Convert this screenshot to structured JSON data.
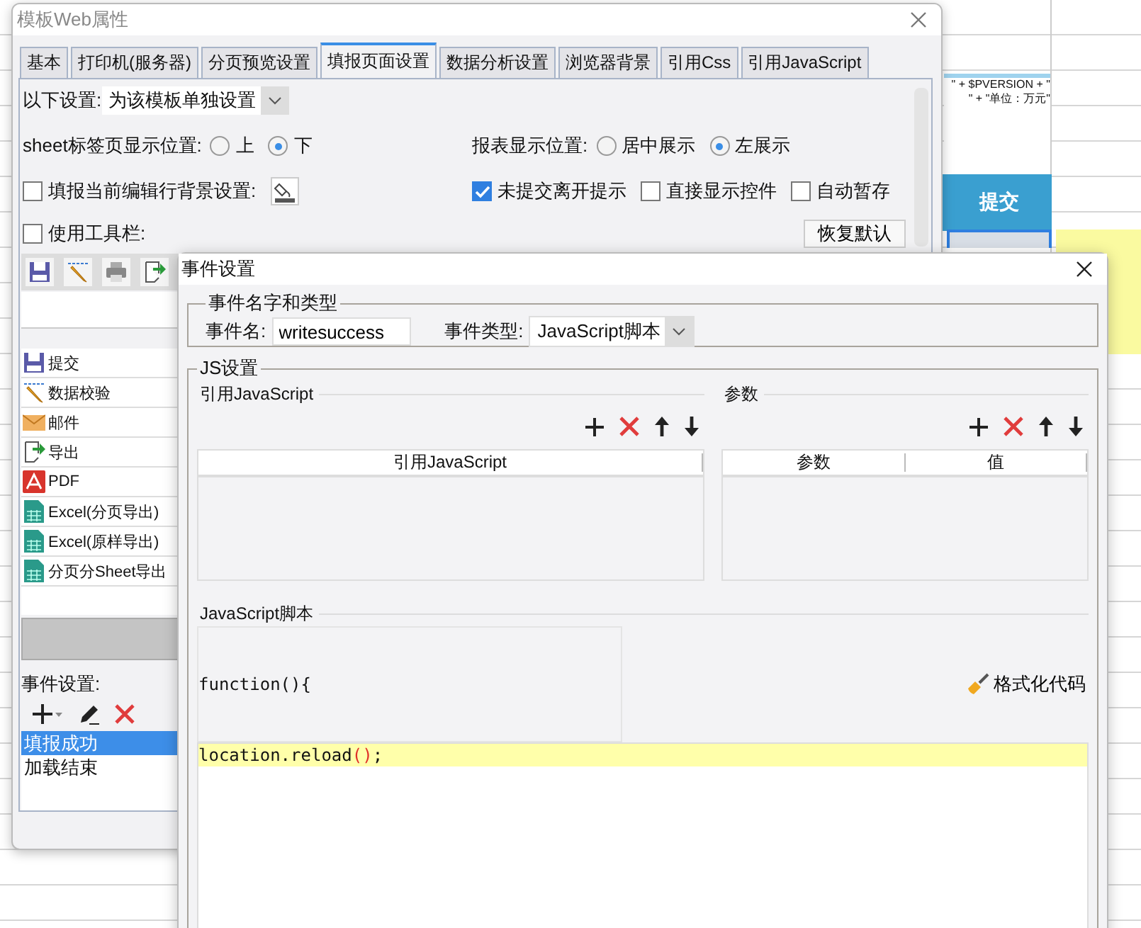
{
  "background": {
    "formula_lines": [
      "\" + $PVERSION + \"",
      "\" + \"单位：万元\""
    ],
    "submit_button": "提交"
  },
  "web_window": {
    "title": "模板Web属性",
    "tabs": [
      {
        "label": "基本",
        "selected": false
      },
      {
        "label": "打印机(服务器)",
        "selected": false
      },
      {
        "label": "分页预览设置",
        "selected": false
      },
      {
        "label": "填报页面设置",
        "selected": true
      },
      {
        "label": "数据分析设置",
        "selected": false
      },
      {
        "label": "浏览器背景",
        "selected": false
      },
      {
        "label": "引用Css",
        "selected": false
      },
      {
        "label": "引用JavaScript",
        "selected": false
      }
    ],
    "setting": {
      "label": "以下设置:",
      "value": "为该模板单独设置"
    },
    "sheet_position": {
      "label": "sheet标签页显示位置:",
      "options": [
        {
          "label": "上",
          "selected": false
        },
        {
          "label": "下",
          "selected": true
        }
      ]
    },
    "report_position": {
      "label": "报表显示位置:",
      "options": [
        {
          "label": "居中展示",
          "selected": false
        },
        {
          "label": "左展示",
          "selected": true
        }
      ]
    },
    "row_background": {
      "label": "填报当前编辑行背景设置:",
      "checked": false
    },
    "options": [
      {
        "label": "未提交离开提示",
        "checked": true
      },
      {
        "label": "直接显示控件",
        "checked": false
      },
      {
        "label": "自动暂存",
        "checked": false
      }
    ],
    "use_toolbar": {
      "label": "使用工具栏:",
      "checked": false
    },
    "restore_button": "恢复默认",
    "toolbar_buttons": [
      {
        "label": "提交",
        "kind": "save"
      },
      {
        "label": "数据校验",
        "kind": "validate"
      },
      {
        "label": "邮件",
        "kind": "mail"
      },
      {
        "label": "导出",
        "kind": "export"
      },
      {
        "label": "PDF",
        "kind": "pdf"
      },
      {
        "label": "Excel(分页导出)",
        "kind": "excel"
      },
      {
        "label": "Excel(原样导出)",
        "kind": "excel"
      },
      {
        "label": "分页分Sheet导出",
        "kind": "excel"
      }
    ],
    "events_label": "事件设置:",
    "events": [
      {
        "label": "填报成功",
        "selected": true
      },
      {
        "label": "加载结束",
        "selected": false
      }
    ]
  },
  "event_window": {
    "title": "事件设置",
    "name_group": {
      "legend": "事件名字和类型",
      "name_label": "事件名:",
      "name_value": "writesuccess",
      "type_label": "事件类型:",
      "type_value": "JavaScript脚本"
    },
    "js_group": {
      "legend": "JS设置",
      "imports": {
        "title": "引用JavaScript",
        "columns": [
          "引用JavaScript"
        ]
      },
      "params": {
        "title": "参数",
        "columns": [
          "参数",
          "值"
        ]
      },
      "script_title": "JavaScript脚本",
      "function_header": "function(){",
      "format_button": "格式化代码",
      "code_lines": [
        {
          "text": "location.reload();",
          "current": true
        }
      ]
    }
  }
}
